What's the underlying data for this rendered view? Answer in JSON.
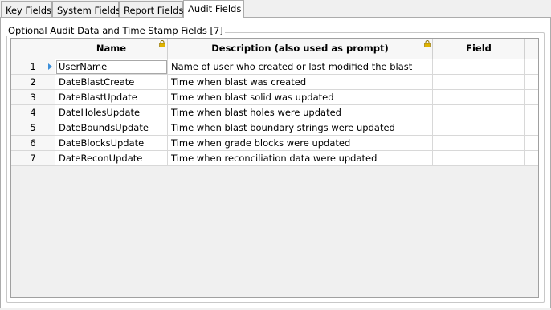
{
  "tabs": [
    {
      "label": "Key Fields"
    },
    {
      "label": "System Fields"
    },
    {
      "label": "Report Fields"
    },
    {
      "label": "Audit Fields"
    }
  ],
  "group": {
    "title": "Optional Audit Data and Time Stamp Fields [7]"
  },
  "table": {
    "columns": [
      {
        "label": ""
      },
      {
        "label": "Name"
      },
      {
        "label": "Description (also used as prompt)"
      },
      {
        "label": "Field"
      }
    ],
    "rows": [
      {
        "num": "1",
        "name": "UserName",
        "description": "Name of user who created or last modified the blast",
        "field": ""
      },
      {
        "num": "2",
        "name": "DateBlastCreate",
        "description": "Time when blast was created",
        "field": ""
      },
      {
        "num": "3",
        "name": "DateBlastUpdate",
        "description": "Time when blast solid was updated",
        "field": ""
      },
      {
        "num": "4",
        "name": "DateHolesUpdate",
        "description": "Time when blast holes were updated",
        "field": ""
      },
      {
        "num": "5",
        "name": "DateBoundsUpdate",
        "description": "Time when blast boundary strings were updated",
        "field": ""
      },
      {
        "num": "6",
        "name": "DateBlocksUpdate",
        "description": "Time when grade blocks were updated",
        "field": ""
      },
      {
        "num": "7",
        "name": "DateReconUpdate",
        "description": "Time when reconciliation data were updated",
        "field": ""
      }
    ]
  },
  "colors": {
    "current_row_marker": "#3b8fd9",
    "lock": "#e0b400"
  }
}
